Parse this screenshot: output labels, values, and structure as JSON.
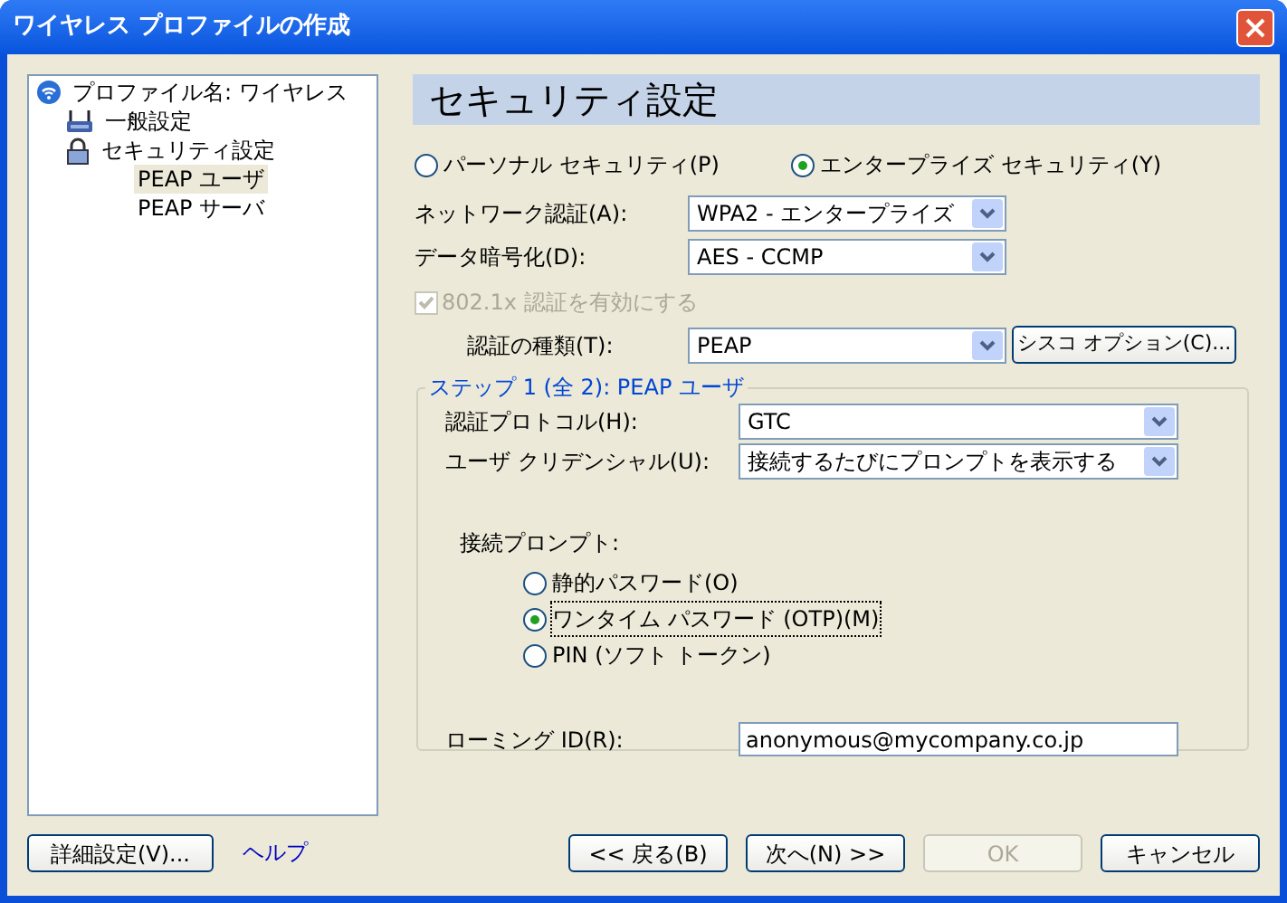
{
  "window": {
    "title": "ワイヤレス プロファイルの作成"
  },
  "tree": [
    {
      "label": "プロファイル名: ワイヤレス",
      "kind": "wireless",
      "selected": false,
      "children": [
        {
          "label": "一般設定",
          "kind": "router",
          "selected": false
        },
        {
          "label": "セキュリティ設定",
          "kind": "lock",
          "selected": false,
          "children": [
            {
              "label": "PEAP ユーザ",
              "selected": true
            },
            {
              "label": "PEAP サーバ",
              "selected": false
            }
          ]
        }
      ]
    }
  ],
  "heading": "セキュリティ設定",
  "security_modes": [
    {
      "label": "パーソナル セキュリティ(P)",
      "selected": false
    },
    {
      "label": "エンタープライズ セキュリティ(Y)",
      "selected": true
    }
  ],
  "network_auth": {
    "label": "ネットワーク認証(A):",
    "value": "WPA2 - エンタープライズ"
  },
  "data_encryption": {
    "label": "データ暗号化(D):",
    "value": "AES - CCMP"
  },
  "enable_8021x": {
    "label": "802.1x 認証を有効にする",
    "checked": true,
    "disabled": true
  },
  "auth_type": {
    "label": "認証の種類(T):",
    "value": "PEAP",
    "button": "シスコ オプション(C)..."
  },
  "step_group": {
    "title": "ステップ 1 (全 2): PEAP ユーザ",
    "auth_protocol": {
      "label": "認証プロトコル(H):",
      "value": "GTC"
    },
    "user_credentials": {
      "label": "ユーザ クリデンシャル(U):",
      "value": "接続するたびにプロンプトを表示する"
    },
    "prompt_label": "接続プロンプト:",
    "prompt_options": [
      {
        "label": "静的パスワード(O)",
        "selected": false
      },
      {
        "label": "ワンタイム パスワード (OTP)(M)",
        "selected": true
      },
      {
        "label": "PIN (ソフト トークン)",
        "selected": false
      }
    ],
    "roaming_id": {
      "label": "ローミング ID(R):",
      "value": "anonymous@mycompany.co.jp"
    }
  },
  "footer": {
    "advanced": "詳細設定(V)...",
    "help": "ヘルプ",
    "back": "<< 戻る(B)",
    "next": "次へ(N) >>",
    "ok": {
      "label": "OK",
      "disabled": true
    },
    "cancel": "キャンセル"
  }
}
